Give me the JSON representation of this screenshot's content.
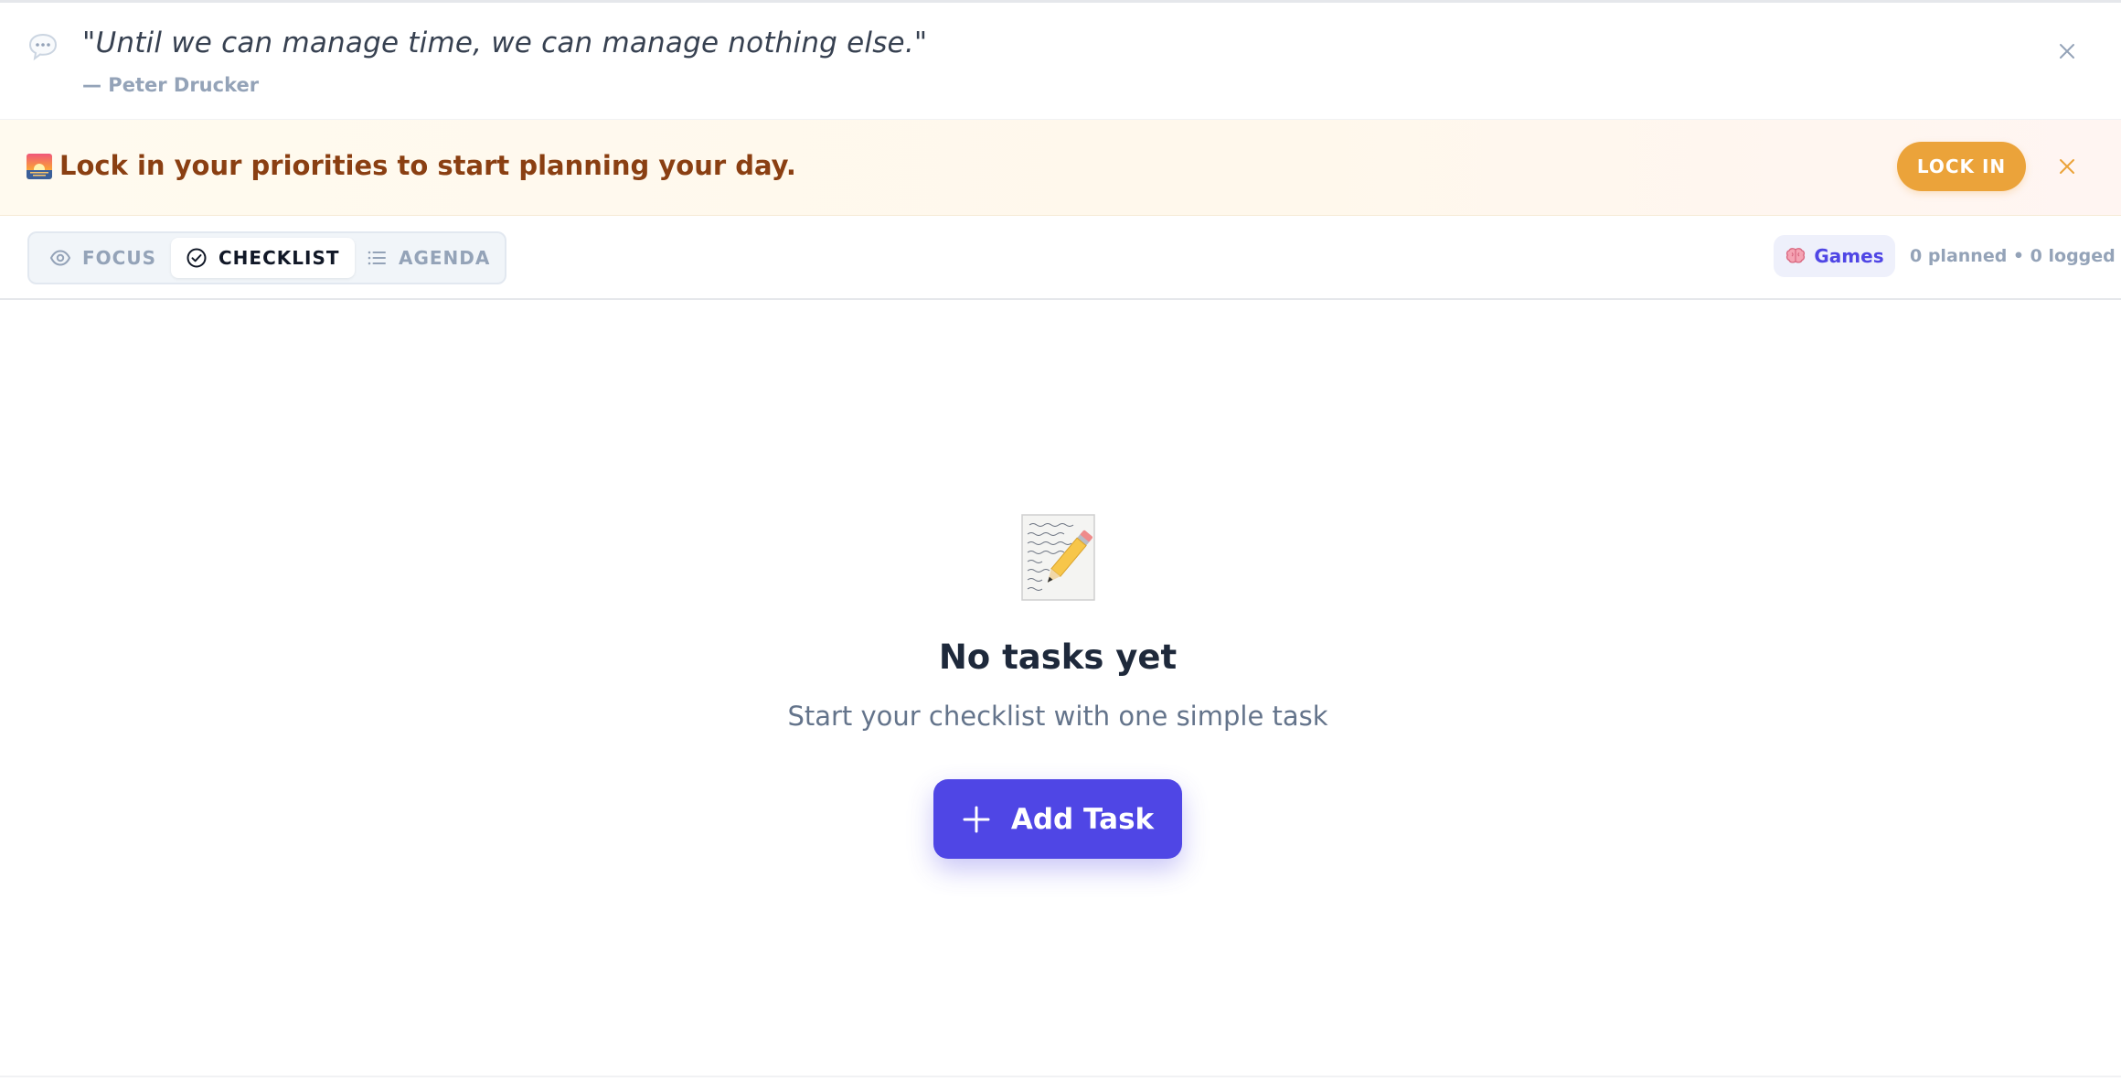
{
  "quote": {
    "text": "\"Until we can manage time, we can manage nothing else.\"",
    "author": "— Peter Drucker",
    "icon": "speech-bubble-icon",
    "close_icon": "close-icon"
  },
  "banner": {
    "emoji_icon": "sunrise-icon",
    "message": "Lock in your priorities to start planning your day.",
    "button_label": "LOCK IN",
    "close_icon": "close-icon",
    "accent_color": "#eba33a",
    "text_color": "#8a3f12"
  },
  "tabs": [
    {
      "label": "FOCUS",
      "icon": "eye-icon",
      "active": false
    },
    {
      "label": "CHECKLIST",
      "icon": "check-circle-icon",
      "active": true
    },
    {
      "label": "AGENDA",
      "icon": "list-icon",
      "active": false
    }
  ],
  "toolbar": {
    "games_label": "Games",
    "games_icon": "brain-icon",
    "stats": "0 planned • 0 logged"
  },
  "empty_state": {
    "illustration": "memo-pencil-icon",
    "title": "No tasks yet",
    "subtitle": "Start your checklist with one simple task",
    "button_label": "Add Task",
    "button_icon": "plus-icon",
    "button_color": "#4f46e5"
  }
}
